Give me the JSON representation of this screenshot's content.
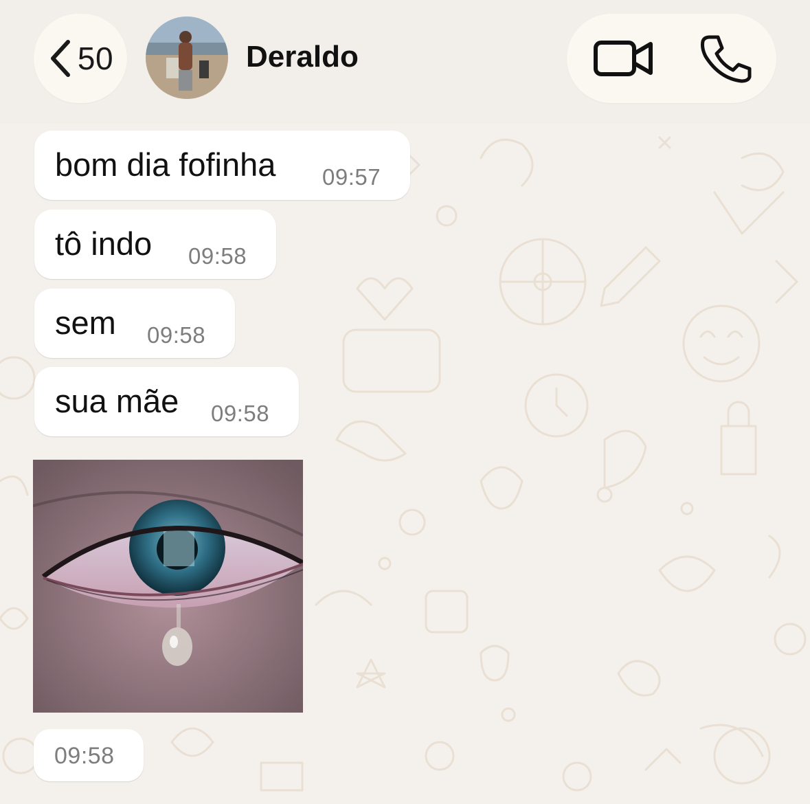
{
  "header": {
    "back_count": "50",
    "contact_name": "Deraldo",
    "avatar_icon": "contact-avatar-photo",
    "back_icon": "chevron-left-icon",
    "video_icon": "video-camera-icon",
    "call_icon": "phone-icon"
  },
  "messages": [
    {
      "text": "bom dia fofinha",
      "time": "09:57"
    },
    {
      "text": "tô indo",
      "time": "09:58"
    },
    {
      "text": "sem",
      "time": "09:58"
    },
    {
      "text": "sua mãe",
      "time": "09:58"
    }
  ],
  "image_message": {
    "icon": "crying-eye-photo",
    "time": "09:58"
  },
  "colors": {
    "background": "#f4f1ec",
    "wallpaper_doodle": "#e8ded2",
    "bubble": "#ffffff",
    "pill": "#fbf8f2",
    "timestamp": "#7d7d7d"
  }
}
